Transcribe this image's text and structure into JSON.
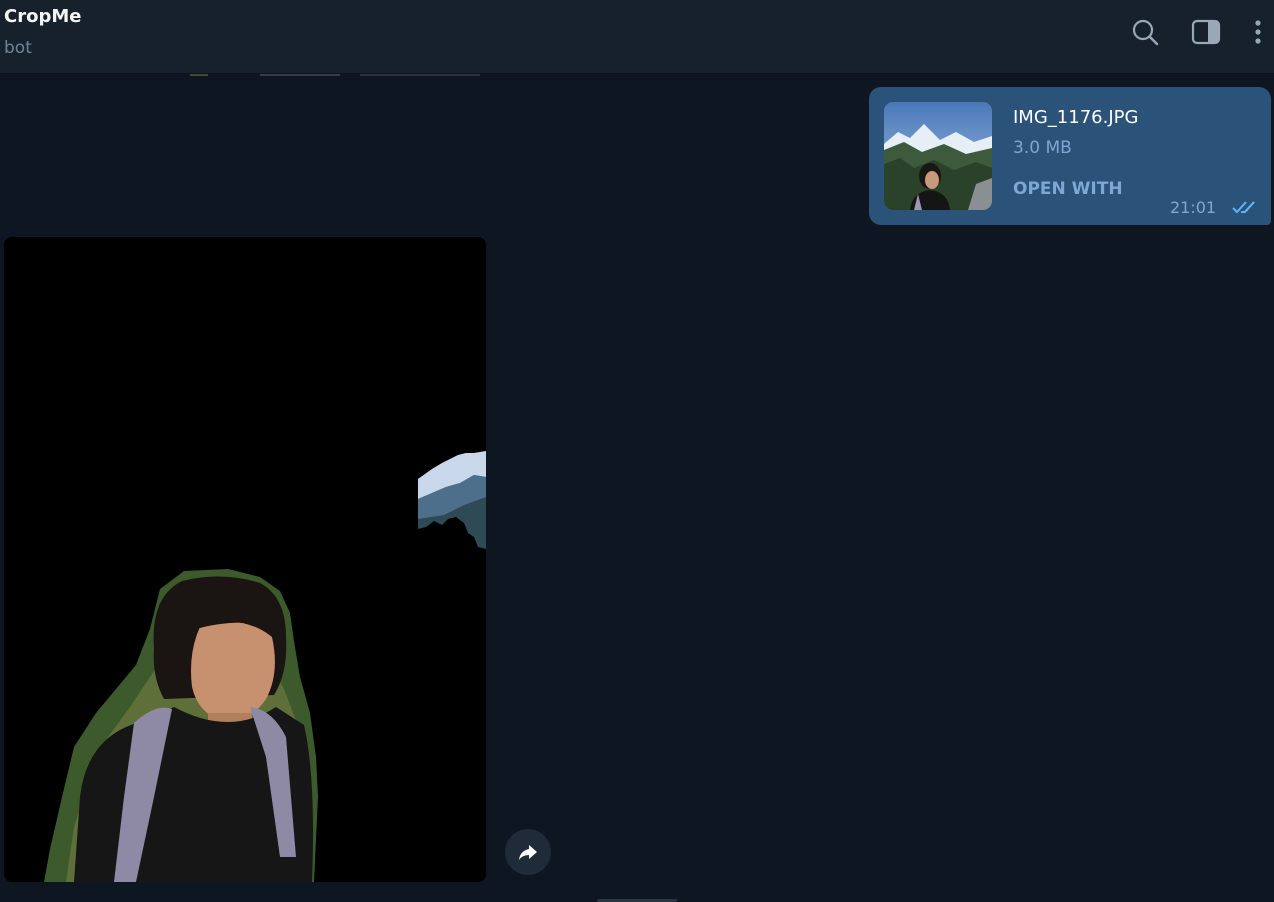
{
  "header": {
    "title": "CropMe",
    "subtitle": "bot",
    "icons": [
      "search-icon",
      "sidebar-toggle-icon",
      "more-vertical-icon"
    ]
  },
  "messages": {
    "file": {
      "name": "IMG_1176.JPG",
      "size": "3.0 MB",
      "action": "OPEN WITH",
      "time": "21:01",
      "status_icon": "double-check-icon"
    },
    "photo": {
      "forward_icon": "forward-arrow-icon"
    }
  },
  "colors": {
    "header_bg": "#17212b",
    "chat_bg": "#0e1621",
    "outgoing_bubble": "#2b5278",
    "accent_text": "#7da8d3",
    "check_color": "#5eb5f7"
  }
}
